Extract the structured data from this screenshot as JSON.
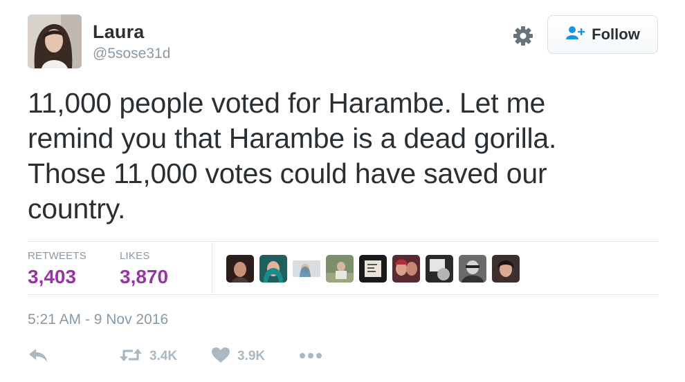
{
  "user": {
    "name": "Laura",
    "handle": "@5sose31d"
  },
  "follow_button": {
    "label": "Follow",
    "icon": "add-user-icon"
  },
  "settings_icon": "gear-icon",
  "tweet": {
    "text_lines": [
      "11,000 people voted for Harambe. Let me",
      "remind you that Harambe is a dead gorilla.",
      "Those 11,000 votes could have saved our",
      "country."
    ]
  },
  "stats": {
    "retweets_label": "RETWEETS",
    "retweets_value": "3,403",
    "likes_label": "LIKES",
    "likes_value": "3,870"
  },
  "timestamp": "5:21 AM - 9 Nov 2016",
  "actions": {
    "reply_icon": "reply-icon",
    "retweet_icon": "retweet-icon",
    "retweet_count": "3.4K",
    "like_icon": "heart-icon",
    "like_count": "3.9K",
    "more_icon": "more-dots-icon"
  },
  "colors": {
    "stat_value": "#9933a7",
    "muted": "#8899a6",
    "icon": "#aab8c2",
    "text": "#292f33",
    "divider": "#e1e8ed"
  }
}
